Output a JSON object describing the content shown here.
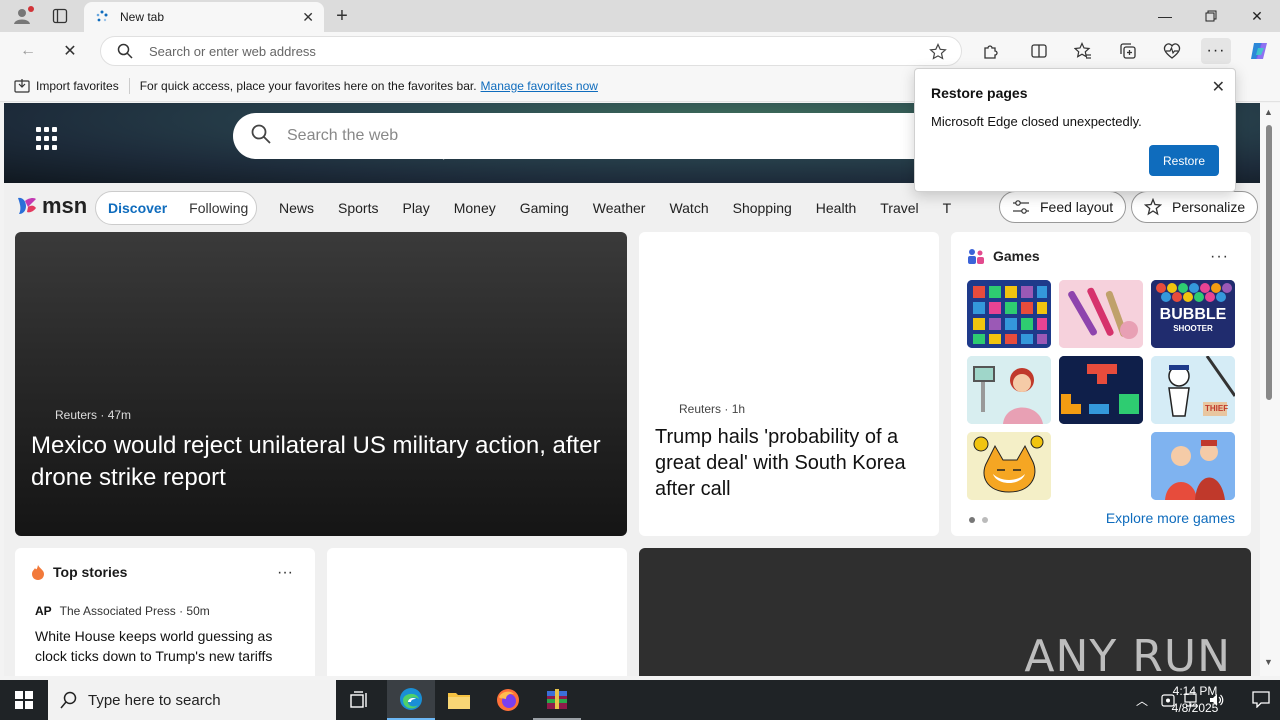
{
  "browser": {
    "tab_title": "New tab",
    "address_placeholder": "Search or enter web address"
  },
  "favorites_bar": {
    "import_label": "Import favorites",
    "message": "For quick access, place your favorites here on the favorites bar.",
    "manage_link": "Manage favorites now"
  },
  "msn": {
    "logo_text": "msn",
    "search_placeholder": "Search the web",
    "feed_toggle": {
      "discover": "Discover",
      "following": "Following"
    },
    "nav_items": [
      "News",
      "Sports",
      "Play",
      "Money",
      "Gaming",
      "Weather",
      "Watch",
      "Shopping",
      "Health",
      "Travel",
      "Tra"
    ],
    "feed_layout_label": "Feed layout",
    "personalize_label": "Personalize"
  },
  "lead_story": {
    "source": "Reuters",
    "age": "47m",
    "title": "Mexico would reject unilateral US military action, after drone strike report"
  },
  "middle_story": {
    "source": "Reuters",
    "age": "1h",
    "title": "Trump hails 'probability of a great deal' with South Korea after call"
  },
  "games": {
    "title": "Games",
    "explore": "Explore more games",
    "bubble_text": "BUBBLE",
    "shooter_text": "SHOOTER",
    "thief_text": "THIEF"
  },
  "top_stories": {
    "title": "Top stories",
    "source_logo": "AP",
    "source": "The Associated Press",
    "age": "50m",
    "headline": "White House keeps world guessing as clock ticks down to Trump's new tariffs"
  },
  "restore_popup": {
    "title": "Restore pages",
    "message": "Microsoft Edge closed unexpectedly.",
    "button": "Restore"
  },
  "watermark": "ANY RUN",
  "taskbar": {
    "search_placeholder": "Type here to search",
    "time": "4:14 PM",
    "date": "4/8/2025"
  },
  "colors": {
    "accent": "#0f6cbd",
    "taskbar": "#1f2326"
  }
}
